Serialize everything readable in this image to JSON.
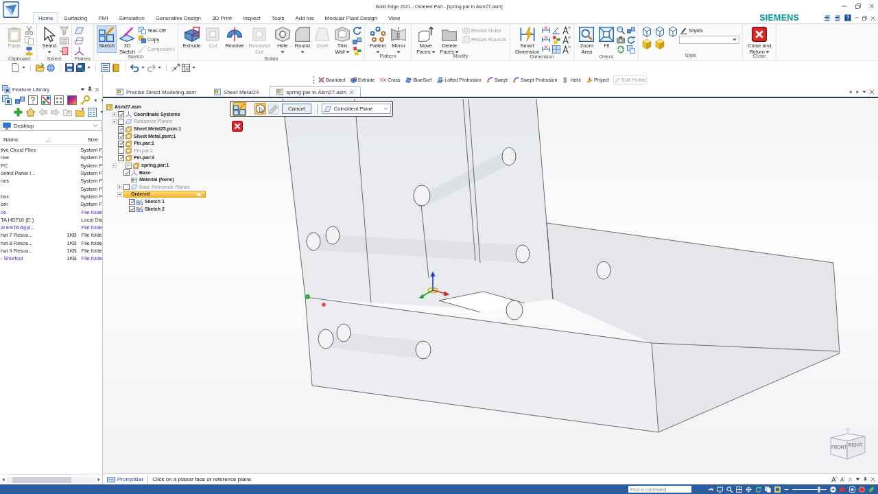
{
  "window": {
    "title": "Solid Edge 2021 - Ordered Part - [spring.par in Asm27.asm]",
    "brand": "SIEMENS"
  },
  "ribbon": {
    "tabs": [
      {
        "label": "Home",
        "selected": true
      },
      {
        "label": "Surfacing",
        "selected": false
      },
      {
        "label": "PMI",
        "selected": false
      },
      {
        "label": "Simulation",
        "selected": false
      },
      {
        "label": "Generative Design",
        "selected": false
      },
      {
        "label": "3D Print",
        "selected": false
      },
      {
        "label": "Inspect",
        "selected": false
      },
      {
        "label": "Tools",
        "selected": false
      },
      {
        "label": "Add Ins",
        "selected": false
      },
      {
        "label": "Modular Plant Design",
        "selected": false
      },
      {
        "label": "View",
        "selected": false
      }
    ],
    "groups": [
      {
        "label": "Clipboard",
        "items": [
          {
            "kind": "large",
            "label": "Paste",
            "disabled": true,
            "active": false,
            "menu": false
          }
        ]
      },
      {
        "label": "Select",
        "items": [
          {
            "kind": "large",
            "label": "Select",
            "disabled": false,
            "active": false,
            "menu": true
          }
        ]
      },
      {
        "label": "Planes"
      },
      {
        "label": "Sketch",
        "items": [
          {
            "kind": "large",
            "label": "Sketch",
            "disabled": false,
            "active": true,
            "menu": false
          },
          {
            "kind": "large",
            "label": "3D Sketch",
            "disabled": false,
            "active": false,
            "menu": false
          },
          {
            "kind": "small",
            "label": "Tear-Off",
            "disabled": false
          },
          {
            "kind": "small",
            "label": "Copy",
            "disabled": false
          },
          {
            "kind": "small",
            "label": "Component",
            "disabled": true
          }
        ]
      },
      {
        "label": "Solids",
        "items": [
          {
            "kind": "large",
            "label": "Extrude",
            "disabled": false,
            "active": false,
            "menu": false
          },
          {
            "kind": "large",
            "label": "Cut",
            "disabled": true,
            "active": false,
            "menu": false
          },
          {
            "kind": "large",
            "label": "Revolve",
            "disabled": false,
            "active": false,
            "menu": false
          },
          {
            "kind": "large",
            "label": "Revolved Cut",
            "disabled": true,
            "active": false,
            "menu": false
          },
          {
            "kind": "large",
            "label": "Hole",
            "disabled": false,
            "active": false,
            "menu": true
          },
          {
            "kind": "large",
            "label": "Round",
            "disabled": false,
            "active": false,
            "menu": true
          },
          {
            "kind": "large",
            "label": "Draft",
            "disabled": true,
            "active": false,
            "menu": false
          },
          {
            "kind": "large",
            "label": "Thin Wall",
            "disabled": false,
            "active": false,
            "menu": true
          }
        ]
      },
      {
        "label": "Pattern",
        "items": [
          {
            "kind": "large",
            "label": "Pattern",
            "disabled": false,
            "active": false,
            "menu": true
          },
          {
            "kind": "large",
            "label": "Mirror",
            "disabled": false,
            "active": false,
            "menu": true
          }
        ]
      },
      {
        "label": "Modify",
        "items": [
          {
            "kind": "large",
            "label": "Move Faces",
            "disabled": false,
            "active": false,
            "menu": true
          },
          {
            "kind": "large",
            "label": "Delete Faces",
            "disabled": false,
            "active": false,
            "menu": true
          },
          {
            "kind": "small",
            "label": "Resize Holes",
            "disabled": true
          },
          {
            "kind": "small",
            "label": "Resize Rounds",
            "disabled": true
          }
        ]
      },
      {
        "label": "Dimension",
        "items": [
          {
            "kind": "large",
            "label": "Smart Dimension",
            "disabled": false,
            "active": false,
            "menu": false
          }
        ]
      },
      {
        "label": "Orient",
        "items": [
          {
            "kind": "large",
            "label": "Zoom Area",
            "disabled": false,
            "active": false,
            "menu": false
          },
          {
            "kind": "large",
            "label": "Fit",
            "disabled": false,
            "active": false,
            "menu": false
          }
        ]
      },
      {
        "label": "Style",
        "items": [
          {
            "kind": "small",
            "label": "Styles",
            "disabled": false
          },
          {
            "kind": "dropdown"
          }
        ]
      },
      {
        "label": "Close",
        "items": [
          {
            "kind": "large",
            "label": "Close and Return",
            "disabled": false,
            "active": false,
            "menu": true
          }
        ]
      }
    ]
  },
  "feature_commands": [
    {
      "label": "Bounded",
      "disabled": false
    },
    {
      "label": "Extrude",
      "disabled": false
    },
    {
      "label": "Cross",
      "disabled": false
    },
    {
      "label": "BlueSurf",
      "disabled": false
    },
    {
      "label": "Lofted Protrusion",
      "disabled": false
    },
    {
      "label": "Swept",
      "disabled": false
    },
    {
      "label": "Swept Protrusion",
      "disabled": false
    },
    {
      "label": "Helix",
      "disabled": false
    },
    {
      "label": "Project",
      "disabled": false
    },
    {
      "label": "Edit Profile",
      "disabled": true
    }
  ],
  "feature_library": {
    "title": "Feature Library",
    "location": "Desktop",
    "columns": [
      "Name",
      "Size"
    ],
    "rows": [
      {
        "name": "tive Cloud Files",
        "type": "System F",
        "kind": "normal"
      },
      {
        "name": "rive",
        "type": "System F",
        "kind": "normal"
      },
      {
        "name": "PC",
        "type": "System F",
        "kind": "normal"
      },
      {
        "name": "ontrol Panel I...",
        "type": "System F",
        "kind": "normal"
      },
      {
        "name": "nes",
        "type": "System F",
        "kind": "normal"
      },
      {
        "type": "System F",
        "kind": "normal"
      },
      {
        "name": "box",
        "type": "System F",
        "kind": "normal"
      },
      {
        "name": "ork",
        "type": "System F",
        "kind": "normal"
      },
      {
        "name": "os",
        "type": "File folde",
        "kind": "compressed"
      },
      {
        "name": "TA HD710 (E:)",
        "type": "Local Dis",
        "kind": "normal"
      },
      {
        "name": "al ESTA Appl...",
        "type": "File folde",
        "kind": "compressed"
      },
      {
        "name": "hot 7 Resou...",
        "size": "1KB",
        "type": "File folde",
        "kind": "normal"
      },
      {
        "name": "hot 8 Resou...",
        "size": "1KB",
        "type": "File folde",
        "kind": "normal"
      },
      {
        "name": "hot 9 Resou...",
        "size": "1KB",
        "type": "File folde",
        "kind": "normal"
      },
      {
        "name": "- Shortcut",
        "size": "1KB",
        "type": "File folde",
        "kind": "compressed"
      }
    ]
  },
  "document_tabs": [
    {
      "label": "Precise Direct Modeling.asm",
      "selected": false
    },
    {
      "label": "Sheet Metal24",
      "selected": false
    },
    {
      "label": "spring.par in Asm27.asm",
      "selected": true
    }
  ],
  "pathfinder": {
    "items": [
      {
        "label": "Asm27.asm",
        "kind": "assembly",
        "selected": false,
        "disabled": false,
        "children": [
          {
            "label": "Coordinate Systems",
            "kind": "coordinates",
            "expanded": false,
            "checked": true,
            "selected": false,
            "disabled": false
          },
          {
            "label": "Reference Planes",
            "kind": "planes",
            "expanded": false,
            "checked": false,
            "selected": false,
            "disabled": true
          },
          {
            "label": "Sheet Metal25.psm:1",
            "kind": "part",
            "checked": true,
            "selected": false,
            "disabled": false
          },
          {
            "label": "Sheet Metal.psm:1",
            "kind": "part",
            "checked": true,
            "selected": false,
            "disabled": false
          },
          {
            "label": "Pin.par:1",
            "kind": "part",
            "checked": true,
            "selected": false,
            "disabled": false
          },
          {
            "label": "Pin.par:2",
            "kind": "part",
            "checked": false,
            "selected": false,
            "disabled": true
          },
          {
            "label": "Pin.par:3",
            "kind": "part",
            "checked": true,
            "selected": false,
            "disabled": false
          },
          {
            "label": "spring.par:1",
            "kind": "edit_part",
            "expanded": true,
            "selected": false,
            "disabled": false,
            "children": [
              {
                "label": "Base",
                "kind": "base",
                "checked": true,
                "selected": false,
                "disabled": false
              },
              {
                "label": "Material (None)",
                "kind": "material",
                "selected": false,
                "disabled": false
              },
              {
                "label": "Base Reference Planes",
                "kind": "planes",
                "expanded": false,
                "checked": false,
                "selected": false,
                "disabled": true
              },
              {
                "label": "Ordered",
                "kind": "group",
                "expanded": true,
                "selected": true,
                "disabled": false,
                "children": [
                  {
                    "label": "Sketch 1",
                    "kind": "sketch",
                    "checked": true,
                    "selected": false,
                    "disabled": false
                  },
                  {
                    "label": "Sketch 2",
                    "kind": "sketch",
                    "checked": true,
                    "selected": false,
                    "disabled": false
                  }
                ]
              }
            ]
          }
        ]
      }
    ]
  },
  "command_bar": {
    "steps": [
      {
        "selected": true
      },
      {
        "selected": true
      },
      {
        "selected": false
      }
    ],
    "cancel": "Cancel",
    "plane_option": "Coincident Plane"
  },
  "view_cube": {
    "faces": [
      "FRONT",
      "RIGHT"
    ]
  },
  "prompt_bar": {
    "label": "PromptBar",
    "message": "Click on a planar face or reference plane."
  },
  "taskbar": {
    "search": {
      "placeholder": "Find a command"
    },
    "zoom_slider": {
      "level": 0.78
    }
  }
}
